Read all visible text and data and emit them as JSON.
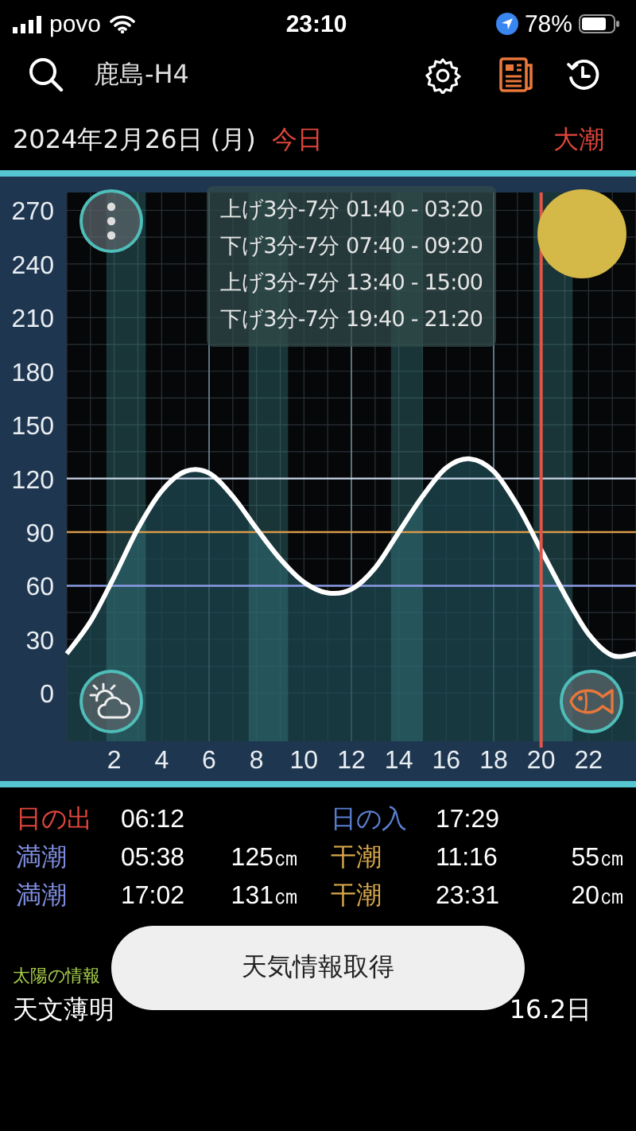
{
  "status_bar": {
    "carrier": "povo",
    "time": "23:10",
    "battery": "78%"
  },
  "header": {
    "location": "鹿島-H4"
  },
  "date_row": {
    "date": "2024年2月26日 (月)",
    "today": "今日",
    "tide_type": "大潮"
  },
  "chart_data": {
    "type": "line",
    "yticks": [
      0,
      30,
      60,
      90,
      120,
      150,
      180,
      210,
      240,
      270
    ],
    "xticks": [
      2,
      4,
      6,
      8,
      10,
      12,
      14,
      16,
      18,
      20,
      22
    ],
    "xlim": [
      0,
      24
    ],
    "ylim": [
      -27,
      280
    ],
    "x": [
      0,
      1,
      2,
      3,
      4,
      5,
      6,
      7,
      8,
      9,
      10,
      11,
      12,
      13,
      14,
      15,
      16,
      17,
      18,
      19,
      20,
      21,
      22,
      23,
      24
    ],
    "grid": true,
    "series": [
      {
        "color": "#ffffff",
        "values": [
          22,
          40,
          65,
          92,
          113,
          124,
          123,
          110,
          92,
          75,
          62,
          56,
          58,
          70,
          90,
          110,
          126,
          131,
          124,
          105,
          80,
          55,
          33,
          21,
          22
        ]
      }
    ],
    "bands": [
      {
        "axis": "x",
        "from": 1.67,
        "to": 3.33
      },
      {
        "axis": "x",
        "from": 7.67,
        "to": 9.33
      },
      {
        "axis": "x",
        "from": 13.67,
        "to": 15
      },
      {
        "axis": "x",
        "from": 19.67,
        "to": 21.33
      }
    ],
    "ref_lines": [
      {
        "axis": "y",
        "value": 120,
        "color": "#c8d4e8"
      },
      {
        "axis": "y",
        "value": 90,
        "color": "#d89a4a"
      },
      {
        "axis": "y",
        "value": 60,
        "color": "#8c9ce8"
      },
      {
        "axis": "x",
        "value": 20,
        "color": "#e0554a"
      }
    ]
  },
  "windows": [
    "上げ3分-7分 01:40 - 03:20",
    "下げ3分-7分 07:40 - 09:20",
    "上げ3分-7分 13:40 - 15:00",
    "下げ3分-7分 19:40 - 21:20"
  ],
  "tide_rows": [
    {
      "cells": [
        {
          "kind": "sunrise",
          "label": "日の出",
          "time": "06:12"
        },
        {
          "kind": "sunset",
          "label": "日の入",
          "time": "17:29"
        }
      ]
    },
    {
      "cells": [
        {
          "kind": "high",
          "label": "満潮",
          "time": "05:38",
          "height": "125㎝"
        },
        {
          "kind": "low",
          "label": "干潮",
          "time": "11:16",
          "height": "55㎝"
        }
      ]
    },
    {
      "cells": [
        {
          "kind": "high",
          "label": "満潮",
          "time": "17:02",
          "height": "131㎝"
        },
        {
          "kind": "low",
          "label": "干潮",
          "time": "23:31",
          "height": "20㎝"
        }
      ]
    }
  ],
  "sun_info": {
    "title": "太陽の情報",
    "rows": [
      {
        "label": "天文薄明",
        "value2": "16.2日"
      }
    ]
  },
  "toast": "天気情報取得"
}
